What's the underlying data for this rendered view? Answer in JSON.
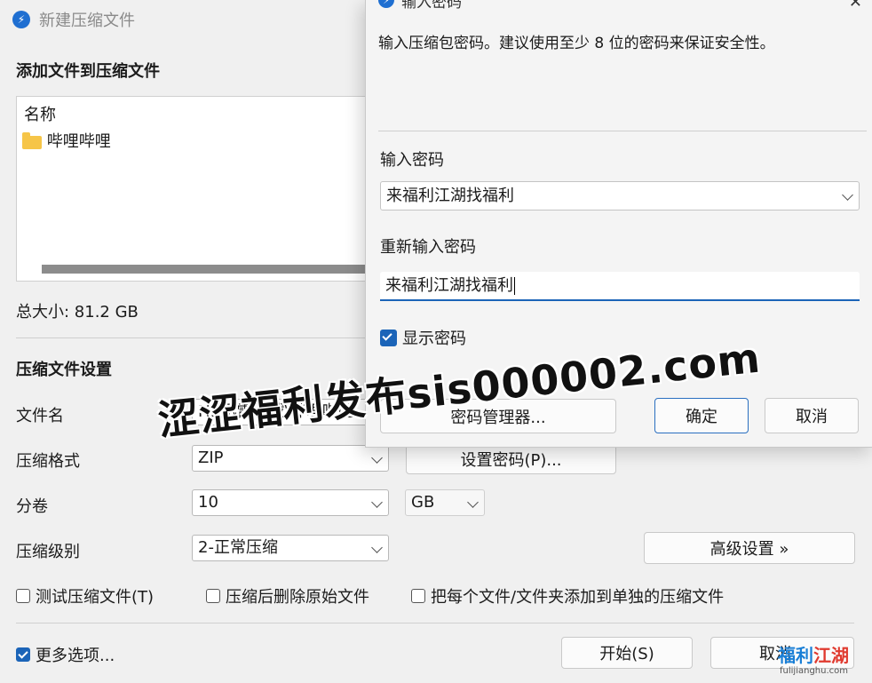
{
  "main": {
    "title": "新建压缩文件",
    "add_section_title": "添加文件到压缩文件",
    "list_header": "名称",
    "list_items": [
      {
        "name": "哔哩哔哩"
      }
    ],
    "total_size": "总大小: 81.2 GB",
    "settings_title": "压缩文件设置",
    "filename_label": "文件名",
    "filename_value": "H:\\迅雷下载\\哔哩哔哩",
    "format_label": "压缩格式",
    "format_value": "ZIP",
    "set_password_button": "设置密码(P)...",
    "split_label": "分卷",
    "split_value": "10",
    "split_unit": "GB",
    "level_label": "压缩级别",
    "level_value": "2-正常压缩",
    "advanced_button": "高级设置 »",
    "checkboxes": [
      {
        "label": "测试压缩文件(T)",
        "checked": false
      },
      {
        "label": "压缩后删除原始文件",
        "checked": false
      },
      {
        "label": "把每个文件/文件夹添加到单独的压缩文件",
        "checked": false
      }
    ],
    "more_options": "更多选项...",
    "more_options_checked": true,
    "start_button": "开始(S)",
    "cancel_button": "取消"
  },
  "dialog": {
    "title": "输入密码",
    "description": "输入压缩包密码。建议使用至少 8 位的密码来保证安全性。",
    "password_label": "输入密码",
    "password_value": "来福利江湖找福利",
    "confirm_label": "重新输入密码",
    "confirm_value": "来福利江湖找福利",
    "show_password_label": "显示密码",
    "show_password_checked": true,
    "manager_button": "密码管理器...",
    "ok_button": "确定",
    "cancel_button": "取消"
  },
  "overlay": {
    "watermark": "涩涩福利发布sis000002.com",
    "logo_text_1": "福利",
    "logo_text_2": "江湖",
    "logo_url": "fulijianghu.com"
  },
  "colors": {
    "accent": "#1b64b8",
    "folder": "#f6c548"
  }
}
